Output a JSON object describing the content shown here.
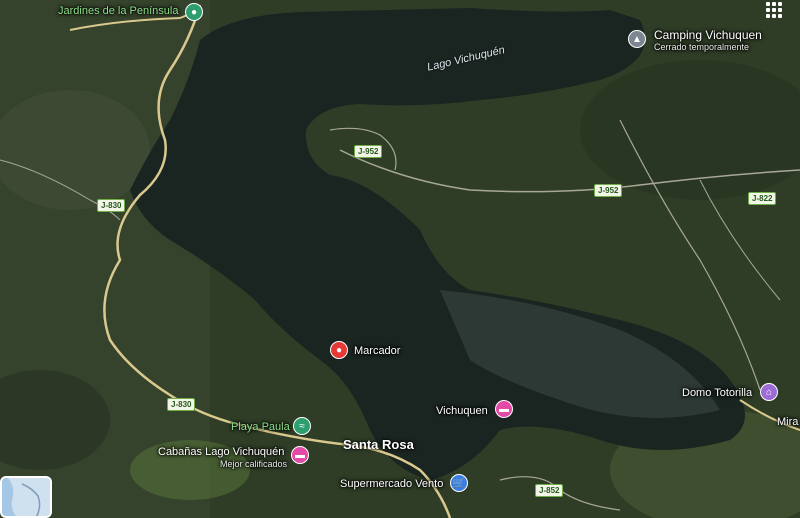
{
  "map": {
    "style": "satellite",
    "colors": {
      "water": "#1a2420",
      "land": "#2f3d27",
      "road": "#d9c98e",
      "road_minor": "#a8a79a"
    }
  },
  "water_labels": {
    "lake": "Lago Vichuquén"
  },
  "places": {
    "jardines": {
      "label": "Jardines de la Península",
      "icon": "park-icon"
    },
    "camping": {
      "label": "Camping Vichuquen",
      "status": "Cerrado temporalmente",
      "icon": "campground-icon"
    },
    "marcador": {
      "label": "Marcador",
      "icon": "red-pin-icon"
    },
    "vichuquen": {
      "label": "Vichuquen",
      "icon": "hotel-icon"
    },
    "domo": {
      "label": "Domo Totorilla",
      "icon": "lodging-icon"
    },
    "mira": {
      "label": "Mira"
    },
    "playa": {
      "label": "Playa Paula",
      "icon": "beach-icon"
    },
    "cabanas": {
      "label": "Cabañas Lago Vichuquén",
      "sub": "Mejor calificados",
      "icon": "hotel-icon"
    },
    "santa_rosa": {
      "label": "Santa Rosa"
    },
    "supermercado": {
      "label": "Supermercado Vento",
      "icon": "shopping-cart-icon"
    }
  },
  "roads": {
    "j952a": "J-952",
    "j952b": "J-952",
    "j822": "J-822",
    "j830a": "J-830",
    "j830b": "J-830",
    "j852": "J-852"
  },
  "controls": {
    "apps": "apps-grid-icon",
    "layers": "layers-icon"
  }
}
